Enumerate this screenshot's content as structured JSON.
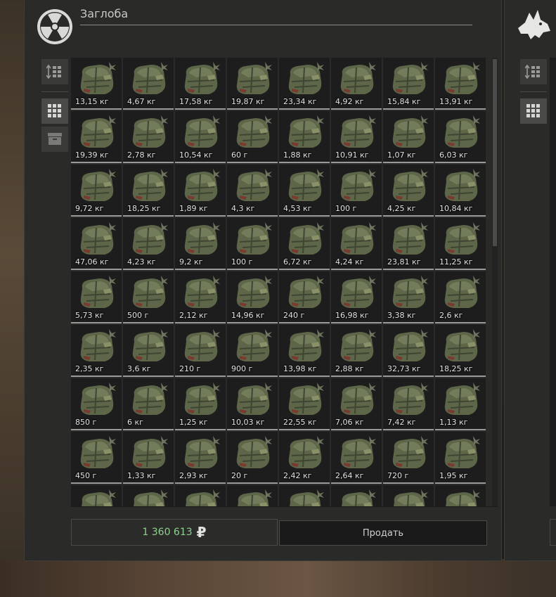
{
  "window": {
    "title": "Заглоба"
  },
  "sidebar": {
    "buttons": [
      {
        "icon": "sort-icon",
        "label": ""
      },
      {
        "icon": "grid-view-icon",
        "label": ""
      },
      {
        "icon": "box-icon",
        "label": ""
      }
    ]
  },
  "inventory": {
    "item_icon": "bag-icon",
    "items": [
      "13,15 кг",
      "4,67 кг",
      "17,58 кг",
      "19,87 кг",
      "23,34 кг",
      "4,92 кг",
      "15,84 кг",
      "13,91 кг",
      "19,39 кг",
      "2,78 кг",
      "10,54 кг",
      "60 г",
      "1,88 кг",
      "10,91 кг",
      "1,07 кг",
      "6,03 кг",
      "9,72 кг",
      "18,25 кг",
      "1,89 кг",
      "4,3 кг",
      "4,53 кг",
      "100 г",
      "4,25 кг",
      "10,84 кг",
      "47,06 кг",
      "4,23 кг",
      "9,2 кг",
      "100 г",
      "6,72 кг",
      "4,24 кг",
      "23,81 кг",
      "11,25 кг",
      "5,73 кг",
      "500 г",
      "2,12 кг",
      "14,96 кг",
      "240 г",
      "16,98 кг",
      "3,38 кг",
      "2,6 кг",
      "2,35 кг",
      "3,6 кг",
      "210 г",
      "900 г",
      "13,98 кг",
      "2,88 кг",
      "32,73 кг",
      "18,25 кг",
      "850 г",
      "6 кг",
      "1,25 кг",
      "10,03 кг",
      "22,55 кг",
      "7,06 кг",
      "7,42 кг",
      "1,13 кг",
      "450 г",
      "1,33 кг",
      "2,93 кг",
      "20 г",
      "2,42 кг",
      "2,64 кг",
      "720 г",
      "1,95 кг",
      "",
      "",
      "",
      "",
      "",
      "",
      "",
      ""
    ]
  },
  "footer": {
    "money": "1 360 613",
    "currency": "₽",
    "sell_label": "Продать"
  },
  "colors": {
    "money": "#8ed18e",
    "panel": "#2a2a29",
    "cell": "#1d1d1d"
  }
}
